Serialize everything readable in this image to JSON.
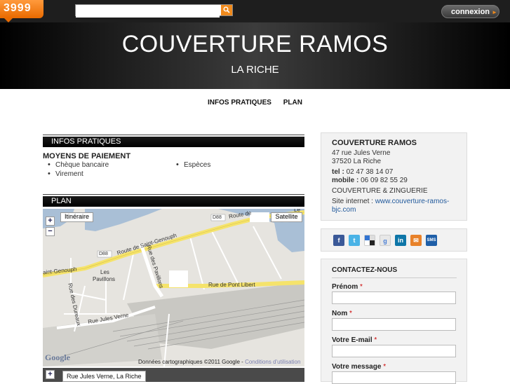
{
  "header": {
    "logo_text": "3999",
    "search": {
      "value": "",
      "placeholder": ""
    },
    "connexion_label": "connexion"
  },
  "banner": {
    "title": "COUVERTURE RAMOS",
    "city": "LA RICHE"
  },
  "nav": {
    "items": [
      "INFOS PRATIQUES",
      "PLAN"
    ]
  },
  "infos": {
    "section_title": "INFOS PRATIQUES",
    "payment_title": "MOYENS DE PAIEMENT",
    "payments": [
      "Chèque bancaire",
      "Espèces",
      "Virement"
    ]
  },
  "plan": {
    "section_title": "PLAN",
    "map_buttons": {
      "itineraire": "Itinéraire",
      "satellite": "Satellite"
    },
    "road_labels": {
      "d88_top": "D88",
      "route_de": "Route de",
      "route_de_saint_genouph": "Route de Saint-Genouph",
      "d88_left": "D88",
      "saint_genouph": "aint-Genouph",
      "rue_des_pavillons": "Rue des Pavillons",
      "les_pavillons_1": "Les",
      "les_pavillons_2": "Pavillons",
      "rue_des_dureaux": "Rue des Dureaux",
      "rue_de_pont_libert": "Rue de Pont Libert",
      "rue_jules_verne": "Rue Jules Verne",
      "le": "Le",
      "s": "S"
    },
    "google": "Google",
    "credit": "Données cartographiques ©2011 Google - ",
    "terms": "Conditions d'utilisation",
    "address_label": "Rue Jules Verne, La Riche"
  },
  "card": {
    "name": "COUVERTURE RAMOS",
    "street": "47 rue Jules Verne",
    "postal_city": "37520 La Riche",
    "tel_label": "tel :",
    "tel": "02 47 38 14 07",
    "mobile_label": "mobile :",
    "mobile": "06 09 82 55 29",
    "activity": "COUVERTURE & ZINGUERIE",
    "site_label": "Site internet :",
    "site_url_1": "www.couverture-ramos-",
    "site_url_2": "bjc.com"
  },
  "social": {
    "icons": [
      "facebook-icon",
      "twitter-icon",
      "delicious-icon",
      "google-icon",
      "linkedin-icon",
      "email-icon",
      "sms-icon"
    ],
    "labels": {
      "facebook": "f",
      "twitter": "t",
      "delicious": "",
      "google": "g",
      "linkedin": "in",
      "email": "✉",
      "sms": "SMS"
    }
  },
  "contact": {
    "title": "CONTACTEZ-NOUS",
    "fields": [
      {
        "label": "Prénom",
        "required": "*"
      },
      {
        "label": "Nom",
        "required": "*"
      },
      {
        "label": "Votre E-mail",
        "required": "*"
      },
      {
        "label": "Votre message",
        "required": "*"
      }
    ]
  },
  "colors": {
    "accent": "#f08a1c",
    "link": "#225a9c",
    "dark": "#000000"
  }
}
